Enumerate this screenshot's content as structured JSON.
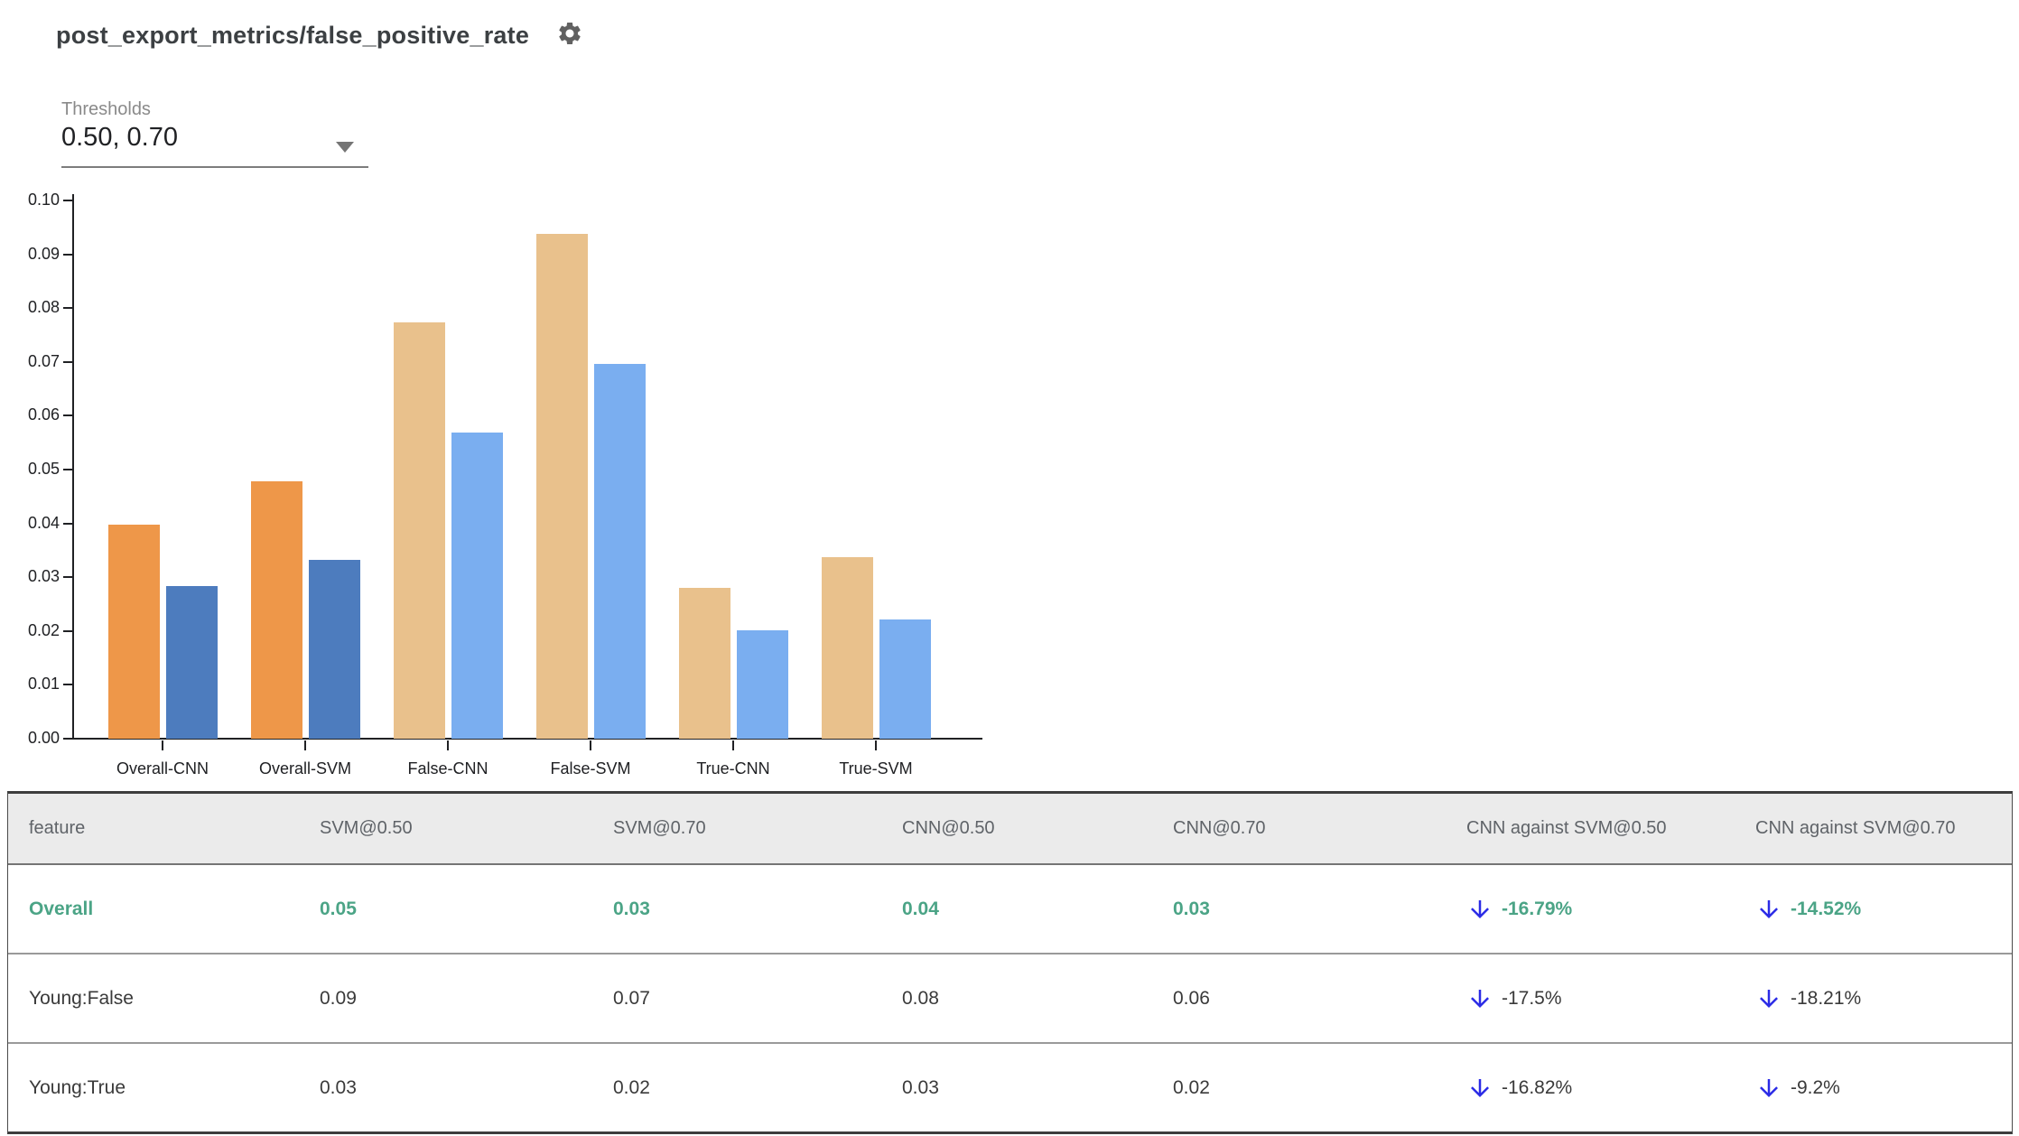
{
  "header": {
    "title": "post_export_metrics/false_positive_rate"
  },
  "thresholds": {
    "label": "Thresholds",
    "value": "0.50, 0.70"
  },
  "chart_data": {
    "type": "bar",
    "title": "post_export_metrics/false_positive_rate",
    "categories": [
      "Overall-CNN",
      "Overall-SVM",
      "False-CNN",
      "False-SVM",
      "True-CNN",
      "True-SVM"
    ],
    "series": [
      {
        "name": "threshold 0.50",
        "values": [
          0.0398,
          0.0478,
          0.0773,
          0.0938,
          0.028,
          0.0338
        ]
      },
      {
        "name": "threshold 0.70",
        "values": [
          0.0284,
          0.0332,
          0.0569,
          0.0696,
          0.0201,
          0.0221
        ]
      }
    ],
    "ylim": [
      0,
      0.1
    ],
    "ytick_step": 0.01,
    "yticks": [
      "0.10",
      "0.09",
      "0.08",
      "0.07",
      "0.06",
      "0.05",
      "0.04",
      "0.03",
      "0.02",
      "0.01",
      "0.00"
    ],
    "grid": false,
    "legend": "none",
    "category_emphasis": [
      true,
      true,
      false,
      false,
      false,
      false
    ],
    "colors": {
      "emphasis": [
        "#EE9749",
        "#4D7CBE"
      ],
      "muted": [
        "#E9C18C",
        "#7AAEF0"
      ]
    }
  },
  "table": {
    "columns": [
      "feature",
      "SVM@0.50",
      "SVM@0.70",
      "CNN@0.50",
      "CNN@0.70",
      "CNN against SVM@0.50",
      "CNN against SVM@0.70"
    ],
    "rows": [
      {
        "feature": "Overall",
        "values": [
          "0.05",
          "0.03",
          "0.04",
          "0.03"
        ],
        "deltas": [
          "-16.79%",
          "-14.52%"
        ],
        "delta_direction": "down",
        "highlight": true
      },
      {
        "feature": "Young:False",
        "values": [
          "0.09",
          "0.07",
          "0.08",
          "0.06"
        ],
        "deltas": [
          "-17.5%",
          "-18.21%"
        ],
        "delta_direction": "down",
        "highlight": false
      },
      {
        "feature": "Young:True",
        "values": [
          "0.03",
          "0.02",
          "0.03",
          "0.02"
        ],
        "deltas": [
          "-16.82%",
          "-9.2%"
        ],
        "delta_direction": "down",
        "highlight": false
      }
    ]
  },
  "colors": {
    "highlight_green": "#4BA486",
    "arrow_blue": "#2B2BE6",
    "header_bg": "#EBEBEB"
  }
}
